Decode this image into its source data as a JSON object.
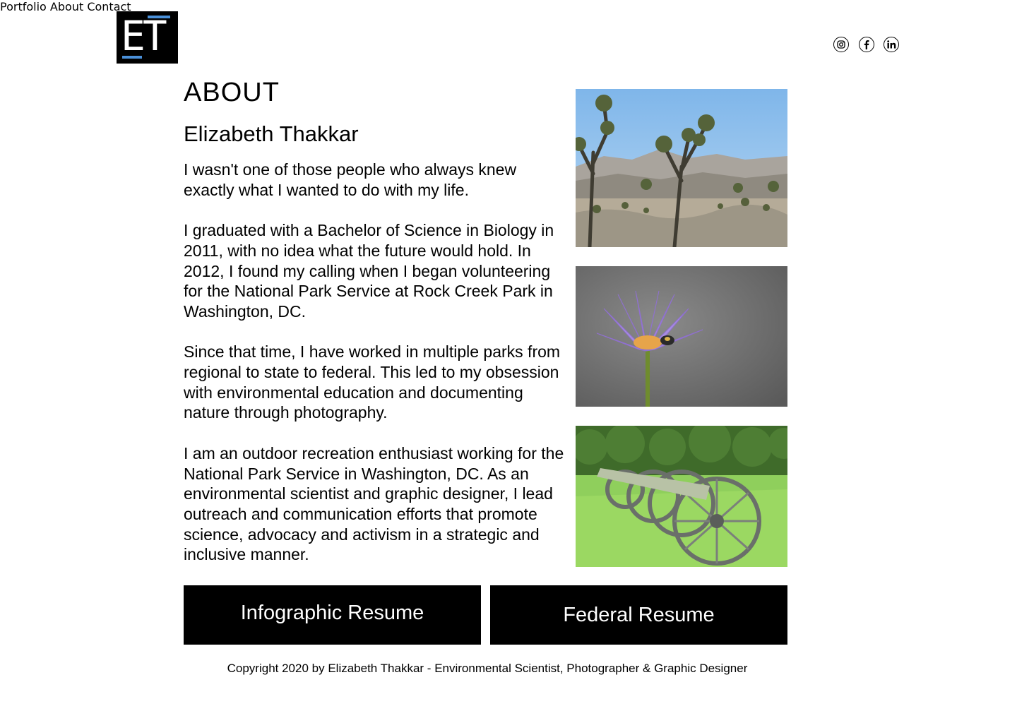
{
  "header": {
    "logo_text": "ET",
    "nav": [
      {
        "label": "Portfolio"
      },
      {
        "label": "About"
      },
      {
        "label": "Contact"
      }
    ],
    "social": [
      {
        "icon": "instagram-icon"
      },
      {
        "icon": "facebook-icon"
      },
      {
        "icon": "linkedin-icon"
      }
    ]
  },
  "main": {
    "title": "ABOUT",
    "name": "Elizabeth Thakkar",
    "paragraphs": [
      "I wasn't one of those people who always knew exactly what I wanted to do with my life.",
      "I graduated with a Bachelor of Science in Biology in 2011, with no idea what the future would hold. In 2012, I found my calling when I began volunteering for the National Park Service at Rock Creek Park in Washington, DC.",
      "Since that time, I have worked in multiple parks from regional to state to federal. This led to my obsession with environmental education and documenting nature through photography.",
      "I am an outdoor recreation enthusiast working for the National Park Service in Washington, DC. As an environmental scientist and graphic designer, I lead outreach and communication efforts that promote science, advocacy and activism in a strategic and inclusive manner."
    ],
    "photos": [
      {
        "subject": "joshua-trees"
      },
      {
        "subject": "purple-water-lily"
      },
      {
        "subject": "cannons-on-grass"
      }
    ],
    "buttons": [
      {
        "label": "Infographic Resume"
      },
      {
        "label": "Federal Resume"
      }
    ]
  },
  "footer": {
    "copyright": "Copyright 2020 by Elizabeth Thakkar - Environmental Scientist, Photographer & Graphic Designer"
  },
  "colors": {
    "logo_bg": "#000000",
    "logo_accent": "#4a90d9",
    "button_bg": "#000000",
    "button_text": "#ffffff"
  }
}
